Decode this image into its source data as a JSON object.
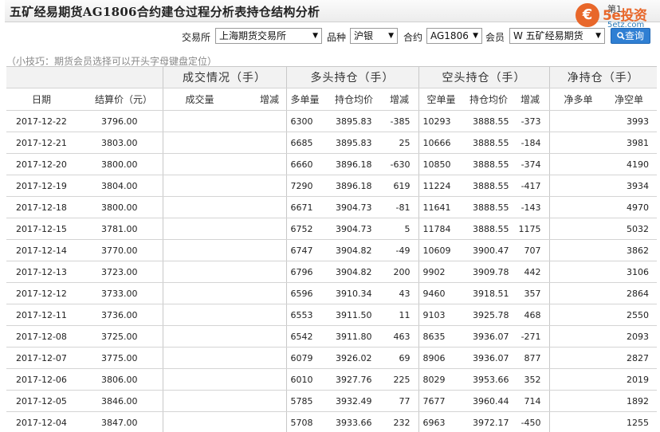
{
  "page_title": "五矿经易期货AG1806合约建仓过程分析表持仓结构分析",
  "corner_text": "第1",
  "logo": {
    "main": "5e投资",
    "sub": "5etz.com",
    "colors": {
      "accent": "#e8672a",
      "sub": "#2a7ab8"
    }
  },
  "filters": {
    "exchange_label": "交易所",
    "exchange_value": "上海期货交易所",
    "variety_label": "品种",
    "variety_value": "沪银",
    "contract_label": "合约",
    "contract_value": "AG1806",
    "member_label": "会员",
    "member_value": "W 五矿经易期货",
    "query_button": "查询",
    "query_icon": "search-icon"
  },
  "tip": "（小技巧：期货会员选择可以开头字母键盘定位）",
  "table": {
    "group_headers": {
      "volume": "成交情况（手）",
      "long": "多头持仓（手）",
      "short": "空头持仓（手）",
      "net": "净持仓（手）"
    },
    "columns": [
      "日期",
      "结算价（元）",
      "成交量",
      "增减",
      "多单量",
      "持仓均价",
      "增减",
      "空单量",
      "持仓均价",
      "增减",
      "净多单",
      "净空单"
    ],
    "rows": [
      {
        "date": "2017-12-22",
        "price": "3796.00",
        "long": "6300",
        "long_avg": "3895.83",
        "long_chg": "-385",
        "long_dir": "down",
        "short": "10293",
        "short_avg": "3888.55",
        "short_chg": "-373",
        "short_dir": "down",
        "net_long": "",
        "net_short": "3993"
      },
      {
        "date": "2017-12-21",
        "price": "3803.00",
        "long": "6685",
        "long_avg": "3895.83",
        "long_chg": "25",
        "long_dir": "up",
        "short": "10666",
        "short_avg": "3888.55",
        "short_chg": "-184",
        "short_dir": "down",
        "net_long": "",
        "net_short": "3981"
      },
      {
        "date": "2017-12-20",
        "price": "3800.00",
        "long": "6660",
        "long_avg": "3896.18",
        "long_chg": "-630",
        "long_dir": "down",
        "short": "10850",
        "short_avg": "3888.55",
        "short_chg": "-374",
        "short_dir": "down",
        "net_long": "",
        "net_short": "4190"
      },
      {
        "date": "2017-12-19",
        "price": "3804.00",
        "long": "7290",
        "long_avg": "3896.18",
        "long_chg": "619",
        "long_dir": "up",
        "short": "11224",
        "short_avg": "3888.55",
        "short_chg": "-417",
        "short_dir": "down",
        "net_long": "",
        "net_short": "3934"
      },
      {
        "date": "2017-12-18",
        "price": "3800.00",
        "long": "6671",
        "long_avg": "3904.73",
        "long_chg": "-81",
        "long_dir": "down",
        "short": "11641",
        "short_avg": "3888.55",
        "short_chg": "-143",
        "short_dir": "down",
        "net_long": "",
        "net_short": "4970"
      },
      {
        "date": "2017-12-15",
        "price": "3781.00",
        "long": "6752",
        "long_avg": "3904.73",
        "long_chg": "5",
        "long_dir": "up",
        "short": "11784",
        "short_avg": "3888.55",
        "short_chg": "1175",
        "short_dir": "up",
        "net_long": "",
        "net_short": "5032"
      },
      {
        "date": "2017-12-14",
        "price": "3770.00",
        "long": "6747",
        "long_avg": "3904.82",
        "long_chg": "-49",
        "long_dir": "down",
        "short": "10609",
        "short_avg": "3900.47",
        "short_chg": "707",
        "short_dir": "up",
        "net_long": "",
        "net_short": "3862"
      },
      {
        "date": "2017-12-13",
        "price": "3723.00",
        "long": "6796",
        "long_avg": "3904.82",
        "long_chg": "200",
        "long_dir": "up",
        "short": "9902",
        "short_avg": "3909.78",
        "short_chg": "442",
        "short_dir": "up",
        "net_long": "",
        "net_short": "3106"
      },
      {
        "date": "2017-12-12",
        "price": "3733.00",
        "long": "6596",
        "long_avg": "3910.34",
        "long_chg": "43",
        "long_dir": "up",
        "short": "9460",
        "short_avg": "3918.51",
        "short_chg": "357",
        "short_dir": "up",
        "net_long": "",
        "net_short": "2864"
      },
      {
        "date": "2017-12-11",
        "price": "3736.00",
        "long": "6553",
        "long_avg": "3911.50",
        "long_chg": "11",
        "long_dir": "up",
        "short": "9103",
        "short_avg": "3925.78",
        "short_chg": "468",
        "short_dir": "up",
        "net_long": "",
        "net_short": "2550"
      },
      {
        "date": "2017-12-08",
        "price": "3725.00",
        "long": "6542",
        "long_avg": "3911.80",
        "long_chg": "463",
        "long_dir": "up",
        "short": "8635",
        "short_avg": "3936.07",
        "short_chg": "-271",
        "short_dir": "down",
        "net_long": "",
        "net_short": "2093"
      },
      {
        "date": "2017-12-07",
        "price": "3775.00",
        "long": "6079",
        "long_avg": "3926.02",
        "long_chg": "69",
        "long_dir": "up",
        "short": "8906",
        "short_avg": "3936.07",
        "short_chg": "877",
        "short_dir": "up",
        "net_long": "",
        "net_short": "2827"
      },
      {
        "date": "2017-12-06",
        "price": "3806.00",
        "long": "6010",
        "long_avg": "3927.76",
        "long_chg": "225",
        "long_dir": "up",
        "short": "8029",
        "short_avg": "3953.66",
        "short_chg": "352",
        "short_dir": "up",
        "net_long": "",
        "net_short": "2019"
      },
      {
        "date": "2017-12-05",
        "price": "3846.00",
        "long": "5785",
        "long_avg": "3932.49",
        "long_chg": "77",
        "long_dir": "up",
        "short": "7677",
        "short_avg": "3960.44",
        "short_chg": "714",
        "short_dir": "up",
        "net_long": "",
        "net_short": "1892"
      },
      {
        "date": "2017-12-04",
        "price": "3847.00",
        "long": "5708",
        "long_avg": "3933.66",
        "long_chg": "232",
        "long_dir": "up",
        "short": "6963",
        "short_avg": "3972.17",
        "short_chg": "-450",
        "short_dir": "down",
        "net_long": "",
        "net_short": "1255"
      }
    ]
  }
}
